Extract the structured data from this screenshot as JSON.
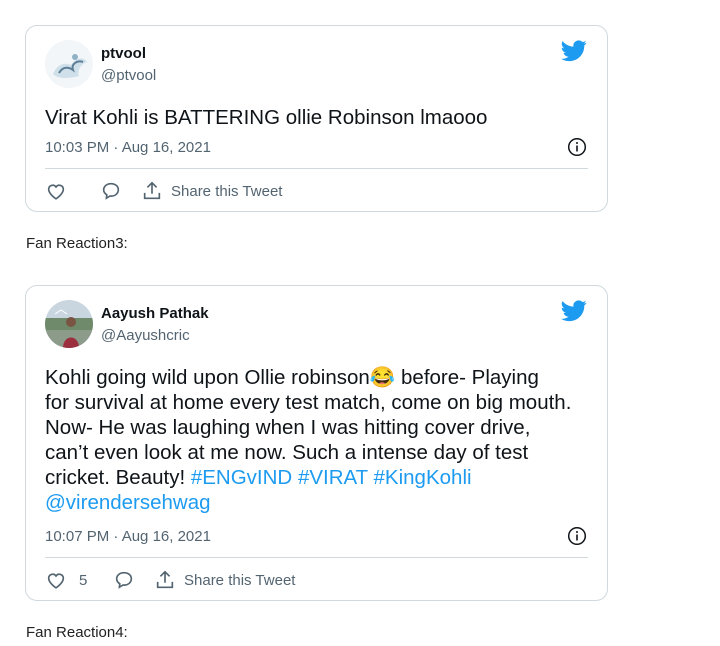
{
  "tweets": [
    {
      "display_name": "ptvool",
      "handle": "@ptvool",
      "text": "Virat Kohli is BATTERING ollie Robinson lmaooo",
      "timestamp": "10:03 PM · Aug 16, 2021",
      "likes": "",
      "share_label": "Share this Tweet"
    },
    {
      "display_name": "Aayush Pathak",
      "handle": "@Aayushcric",
      "text_lines": [
        "Kohli going wild upon Ollie robinson",
        "before- Playing",
        "for survival at home every test match, come on big mouth.",
        "Now- He was laughing when I was hitting cover drive,",
        "can’t even look at me now. Such a intense day of test",
        "cricket. Beauty!",
        "@virendersehwag"
      ],
      "emoji": "😂",
      "hashtags": [
        "#ENGvIND",
        "#VIRAT",
        "#KingKohli"
      ],
      "timestamp": "10:07 PM · Aug 16, 2021",
      "likes": "5",
      "share_label": "Share this Tweet"
    }
  ],
  "captions": [
    "Fan Reaction3:",
    "Fan Reaction4:"
  ],
  "icons": {
    "brand": "twitter-bird-icon",
    "info": "info-icon",
    "like": "heart-icon",
    "reply": "reply-icon",
    "share": "share-icon"
  },
  "colors": {
    "twitter_blue": "#1d9bf0",
    "secondary_text": "#536471",
    "border": "#cfd9de"
  }
}
